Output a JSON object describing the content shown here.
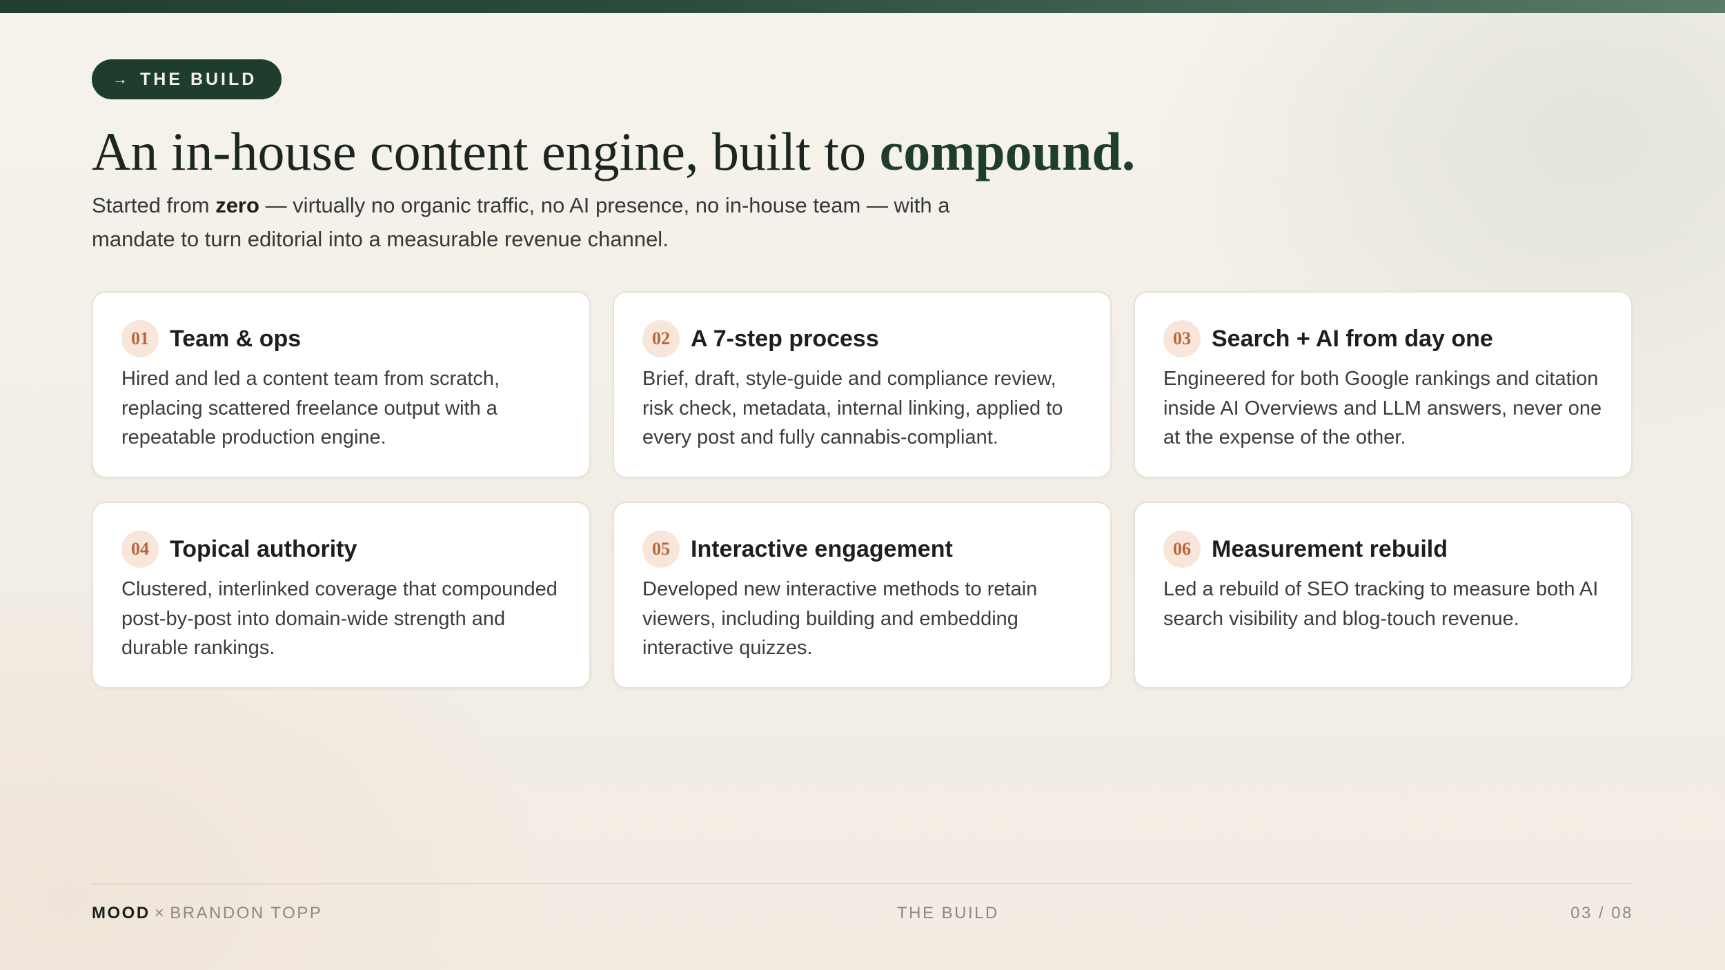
{
  "colors": {
    "accent_green": "#1f3d2d",
    "number_badge_bg": "#f8e6da",
    "number_badge_text": "#b4673a",
    "background": "#f4f0e8"
  },
  "badge": {
    "icon": "right-arrow-icon",
    "arrow": "→",
    "label": "THE BUILD"
  },
  "headline": {
    "text": "An in-house content engine, built to",
    "emphasis": "compound."
  },
  "subtitle": {
    "before": "Started from",
    "bold": "zero",
    "after": "— virtually no organic traffic, no AI presence, no in-house team — with a mandate to turn editorial into a measurable revenue channel."
  },
  "cards": [
    {
      "number": "01",
      "title": "Team & ops",
      "body": "Hired and led a content team from scratch, replacing scattered freelance output with a repeatable production engine."
    },
    {
      "number": "02",
      "title": "A 7-step process",
      "body": "Brief, draft, style-guide and compliance review, risk check, metadata, internal linking, applied to every post and fully cannabis-compliant."
    },
    {
      "number": "03",
      "title": "Search + AI from day one",
      "body": "Engineered for both Google rankings and citation inside AI Overviews and LLM answers, never one at the expense of the other."
    },
    {
      "number": "04",
      "title": "Topical authority",
      "body": "Clustered, interlinked coverage that compounded post-by-post into domain-wide strength and durable rankings."
    },
    {
      "number": "05",
      "title": "Interactive engagement",
      "body": "Developed new interactive methods to retain viewers, including building and embedding interactive quizzes."
    },
    {
      "number": "06",
      "title": "Measurement rebuild",
      "body": "Led a rebuild of SEO tracking to measure both AI search visibility and blog-touch revenue."
    }
  ],
  "footer": {
    "brand": "MOOD",
    "times": "×",
    "author": "BRANDON TOPP",
    "section": "THE BUILD",
    "page": "03 / 08"
  }
}
